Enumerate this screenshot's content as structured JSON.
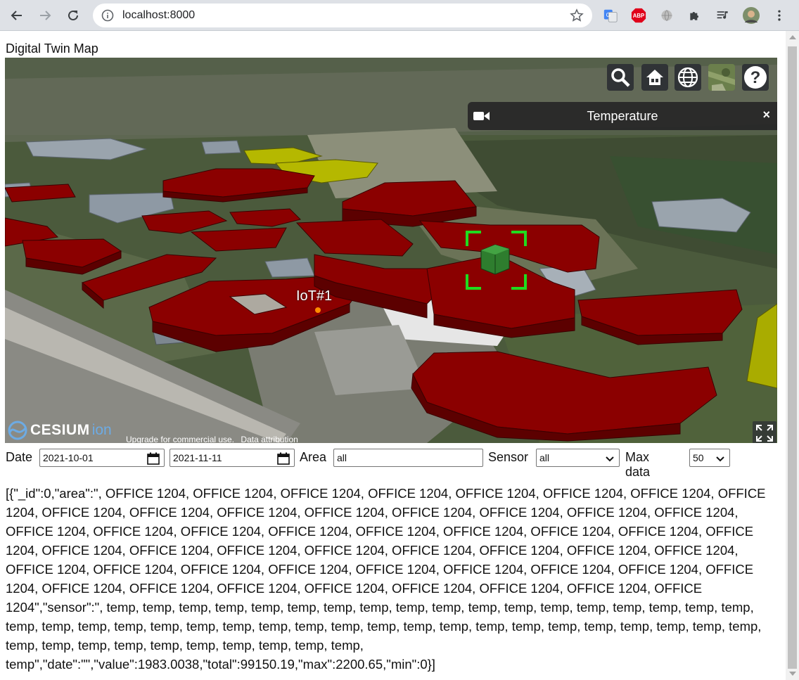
{
  "browser": {
    "url": "localhost:8000"
  },
  "page": {
    "title": "Digital Twin Map"
  },
  "viewer": {
    "infobox_title": "Temperature",
    "close_glyph": "×",
    "iot_label": "IoT#1",
    "logo_word": "CESIUM",
    "logo_suffix": "ion",
    "credits": [
      "Upgrade for commercial use.",
      "Data attribution"
    ],
    "toolbar_icons": [
      "search-icon",
      "home-icon",
      "globe-icon",
      "base-layer-picker-icon",
      "help-icon"
    ],
    "building_color": "#8b0000",
    "selected_color": "#2e7d2e",
    "highlight_color": "#b5b800"
  },
  "filters": {
    "date_label": "Date",
    "date_from": "2021-10-01",
    "date_to": "2021-11-11",
    "area_label": "Area",
    "area_value": "all",
    "sensor_label": "Sensor",
    "sensor_value": "all",
    "max_label": "Max data",
    "max_value": "50"
  },
  "result_text": "[{\"_id\":0,\"area\":\", OFFICE 1204, OFFICE 1204, OFFICE 1204, OFFICE 1204, OFFICE 1204, OFFICE 1204, OFFICE 1204, OFFICE 1204, OFFICE 1204, OFFICE 1204, OFFICE 1204, OFFICE 1204, OFFICE 1204, OFFICE 1204, OFFICE 1204, OFFICE 1204, OFFICE 1204, OFFICE 1204, OFFICE 1204, OFFICE 1204, OFFICE 1204, OFFICE 1204, OFFICE 1204, OFFICE 1204, OFFICE 1204, OFFICE 1204, OFFICE 1204, OFFICE 1204, OFFICE 1204, OFFICE 1204, OFFICE 1204, OFFICE 1204, OFFICE 1204, OFFICE 1204, OFFICE 1204, OFFICE 1204, OFFICE 1204, OFFICE 1204, OFFICE 1204, OFFICE 1204, OFFICE 1204, OFFICE 1204, OFFICE 1204, OFFICE 1204, OFFICE 1204, OFFICE 1204, OFFICE 1204, OFFICE 1204, OFFICE 1204, OFFICE 1204\",\"sensor\":\", temp, temp, temp, temp, temp, temp, temp, temp, temp, temp, temp, temp, temp, temp, temp, temp, temp, temp, temp, temp, temp, temp, temp, temp, temp, temp, temp, temp, temp, temp, temp, temp, temp, temp, temp, temp, temp, temp, temp, temp, temp, temp, temp, temp, temp, temp, temp, temp, temp, temp\",\"date\":\"\",\"value\":1983.0038,\"total\":99150.19,\"max\":2200.65,\"min\":0}]"
}
